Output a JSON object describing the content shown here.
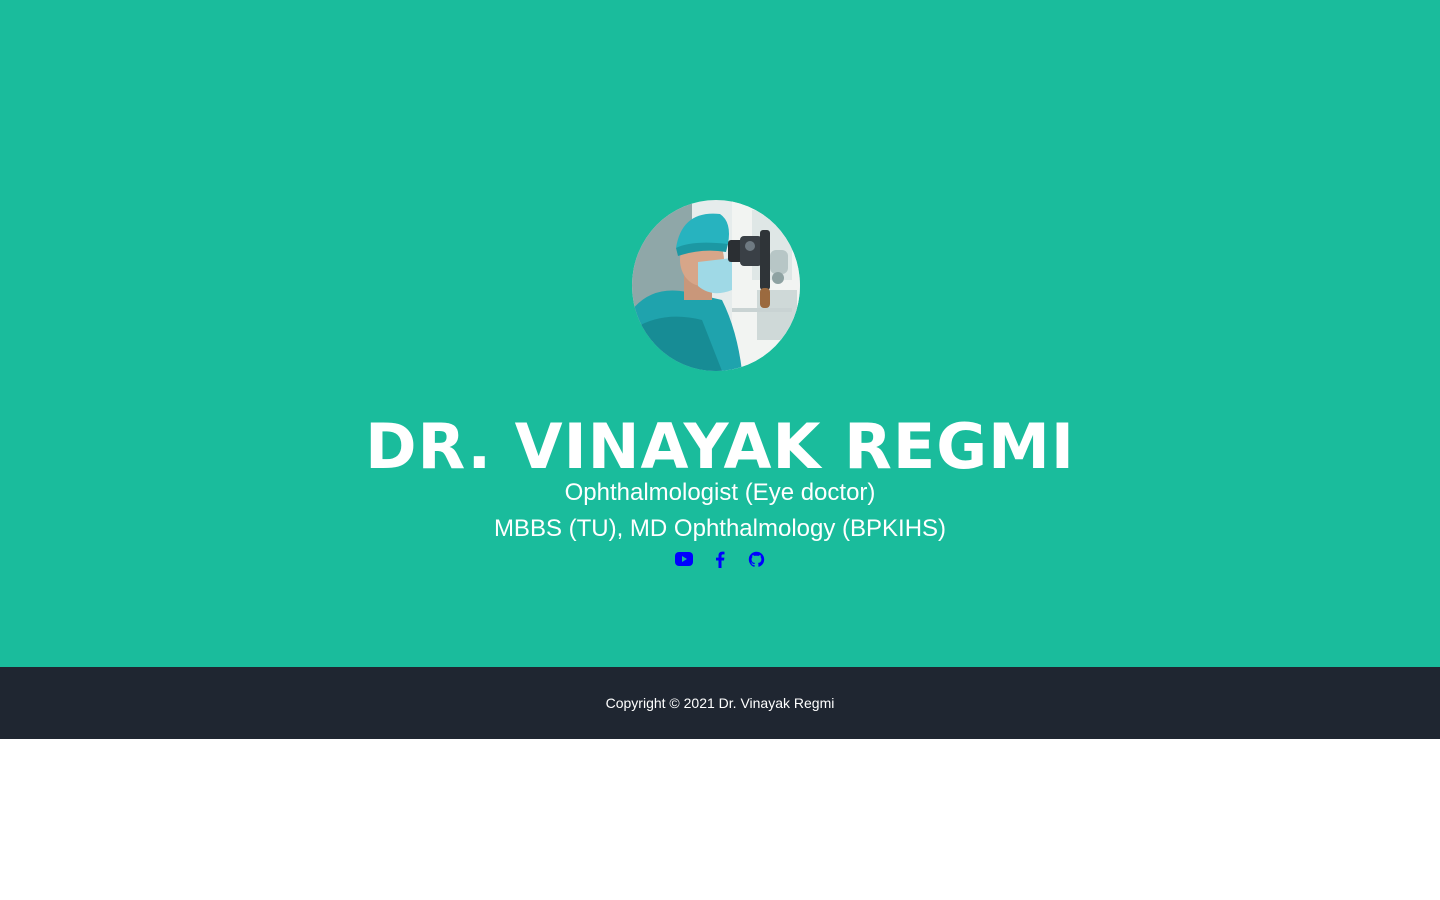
{
  "profile": {
    "name": "DR. VINAYAK REGMI",
    "subtitle_1": "Ophthalmologist (Eye doctor)",
    "subtitle_2": "MBBS (TU), MD Ophthalmology (BPKIHS)"
  },
  "social": [
    {
      "icon": "youtube-icon"
    },
    {
      "icon": "facebook-icon"
    },
    {
      "icon": "github-icon"
    }
  ],
  "footer": {
    "copyright": "Copyright © 2021 Dr. Vinayak Regmi"
  },
  "colors": {
    "hero_bg": "#1abc9c",
    "footer_bg": "#1f2631",
    "link": "#0000ff",
    "text": "#ffffff"
  }
}
